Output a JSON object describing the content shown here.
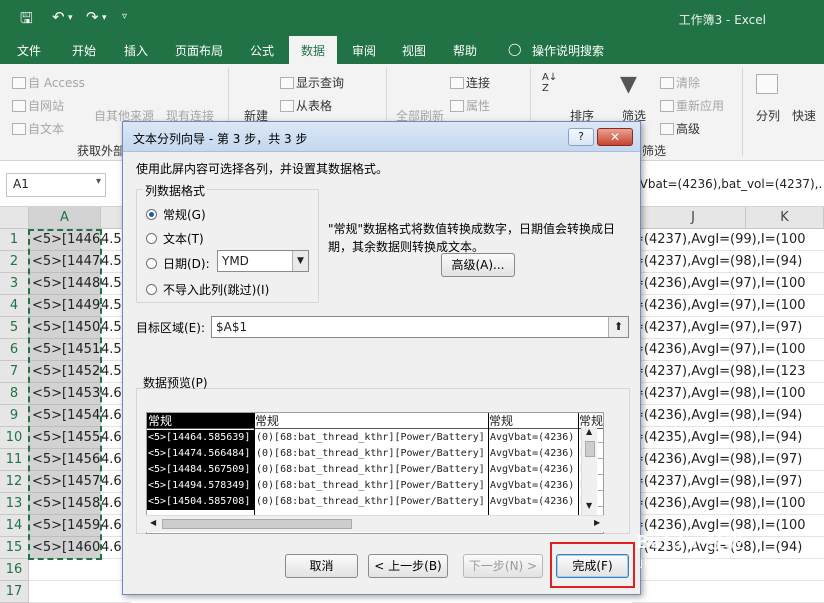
{
  "titlebar": {
    "title": "工作簿3  -  Excel",
    "save_icon": "save-icon",
    "undo_icon": "undo-icon",
    "redo_icon": "redo-icon"
  },
  "menu_tabs": [
    "文件",
    "开始",
    "插入",
    "页面布局",
    "公式",
    "数据",
    "审阅",
    "视图",
    "帮助",
    "操作说明搜索"
  ],
  "active_tab": "数据",
  "ribbon": {
    "get_external": [
      "自 Access",
      "自网站",
      "自文本",
      "自其他来源",
      "现有连接"
    ],
    "get_external_group": "获取外部",
    "new_query": "新建",
    "show_query": "显示查询",
    "from_table": "从表格",
    "refresh_all": "全部刷新",
    "connections": "连接",
    "properties": "属性",
    "sort": "排序",
    "filter": "筛选",
    "clear": "清除",
    "reapply": "重新应用",
    "advanced": "高级",
    "filter_group": "筛选",
    "text_to_columns": "分列",
    "flash_fill": "快速"
  },
  "formula_bar": {
    "namebox": "A1",
    "content": "gVbat=(4236),bat_vol=(4237),."
  },
  "columns": {
    "a": "A",
    "j": "J",
    "k": "K"
  },
  "rows": [
    {
      "n": "1",
      "a": "<5>[1446",
      "b": "4.5",
      "r": "=(4237),AvgI=(99),I=(100"
    },
    {
      "n": "2",
      "a": "<5>[1447",
      "b": "4.5",
      "r": "=(4237),AvgI=(98),I=(94)"
    },
    {
      "n": "3",
      "a": "<5>[1448",
      "b": "4.5",
      "r": "=(4236),AvgI=(97),I=(100"
    },
    {
      "n": "4",
      "a": "<5>[1449",
      "b": "4.5",
      "r": "=(4236),AvgI=(97),I=(100"
    },
    {
      "n": "5",
      "a": "<5>[1450",
      "b": "4.5",
      "r": "=(4237),AvgI=(97),I=(97)"
    },
    {
      "n": "6",
      "a": "<5>[1451",
      "b": "4.5",
      "r": "=(4236),AvgI=(97),I=(100"
    },
    {
      "n": "7",
      "a": "<5>[1452",
      "b": "4.5",
      "r": "=(4237),AvgI=(98),I=(123"
    },
    {
      "n": "8",
      "a": "<5>[1453",
      "b": "4.6",
      "r": "=(4237),AvgI=(98),I=(100"
    },
    {
      "n": "9",
      "a": "<5>[1454",
      "b": "4.6",
      "r": "=(4236),AvgI=(98),I=(94)"
    },
    {
      "n": "10",
      "a": "<5>[1455",
      "b": "4.6",
      "r": "=(4235),AvgI=(98),I=(94)"
    },
    {
      "n": "11",
      "a": "<5>[1456",
      "b": "4.6",
      "r": "=(4236),AvgI=(98),I=(97)"
    },
    {
      "n": "12",
      "a": "<5>[1457",
      "b": "4.6",
      "r": "=(4237),AvgI=(98),I=(97)"
    },
    {
      "n": "13",
      "a": "<5>[1458",
      "b": "4.6",
      "r": "=(4236),AvgI=(98),I=(100"
    },
    {
      "n": "14",
      "a": "<5>[1459",
      "b": "4.6",
      "r": "=(4236),AvgI=(98),I=(100"
    },
    {
      "n": "15",
      "a": "<5>[1460",
      "b": "4.6",
      "r": "=(4236),AvgI=(98),I=(94)"
    },
    {
      "n": "16",
      "a": "",
      "b": "",
      "r": ""
    },
    {
      "n": "17",
      "a": "",
      "b": "",
      "r": ""
    }
  ],
  "dialog": {
    "title": "文本分列向导 - 第 3 步，共 3 步",
    "help": "?",
    "close": "✕",
    "instruction": "使用此屏内容可选择各列，并设置其数据格式。",
    "format_group": "列数据格式",
    "radio_general": "常规(G)",
    "radio_text": "文本(T)",
    "radio_date": "日期(D):",
    "date_format": "YMD",
    "radio_skip": "不导入此列(跳过)(I)",
    "description_line1": "\"常规\"数据格式将数值转换成数字，日期值会转换成日",
    "description_line2": "期，其余数据则转换成文本。",
    "advanced_button": "高级(A)...",
    "destination_label": "目标区域(E):",
    "destination_value": "$A$1",
    "preview_label": "数据预览(P)",
    "preview_headers": [
      "常规",
      "常规",
      "常规",
      "常规"
    ],
    "preview_col1": [
      "<5>[14464.585639]",
      "<5>[14474.566484]",
      "<5>[14484.567509]",
      "<5>[14494.578349]",
      "<5>[14504.585708]"
    ],
    "preview_col2": [
      "(0)[68:bat_thread_kthr][Power/Battery]",
      "(0)[68:bat_thread_kthr][Power/Battery]",
      "(0)[68:bat_thread_kthr][Power/Battery]",
      "(0)[68:bat_thread_kthr][Power/Battery]",
      "(0)[68:bat_thread_kthr][Power/Battery]"
    ],
    "preview_col3": [
      "AvgVbat=(4236)",
      "AvgVbat=(4236)",
      "AvgVbat=(4236)",
      "AvgVbat=(4236)",
      "AvgVbat=(4236)"
    ],
    "preview_col4": [
      "bat_",
      "bat_",
      "bat_",
      "bat_",
      "bat_"
    ],
    "cancel": "取消",
    "back": "< 上一步(B)",
    "next": "下一步(N) >",
    "finish": "完成(F)"
  },
  "watermark": "Baidu 经验",
  "watermark_url": "jingyan.baidu.com",
  "colors": {
    "excel_green": "#217346",
    "highlight_red": "#e02020"
  }
}
